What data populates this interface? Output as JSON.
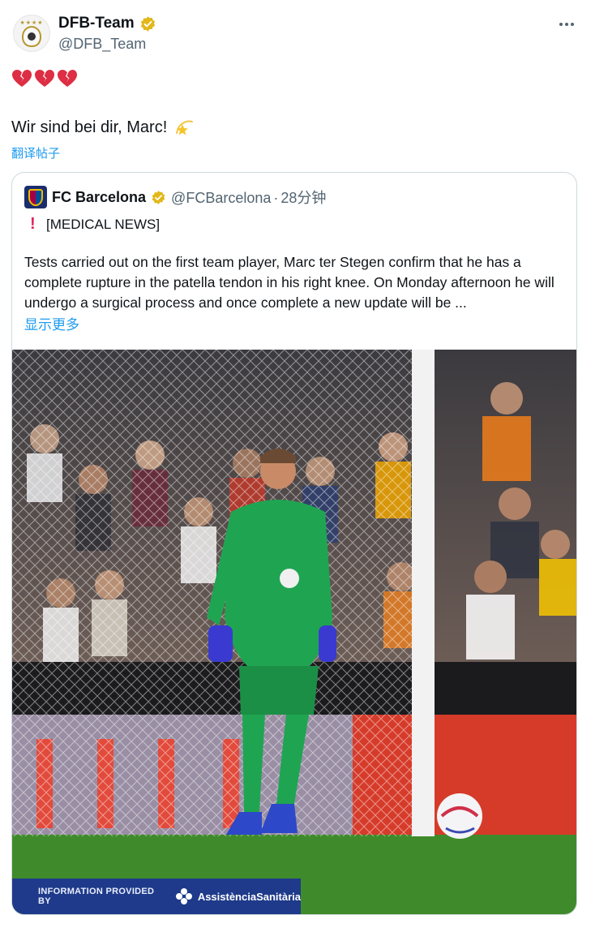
{
  "author": {
    "display_name": "DFB-Team",
    "handle": "@DFB_Team",
    "badge": "gold-verified-badge",
    "avatar": "dfb-crest-logo"
  },
  "menu": {
    "more_icon": "more-horizontal-icon"
  },
  "tweet": {
    "emoji_row": [
      "broken-heart",
      "broken-heart",
      "broken-heart"
    ],
    "text": "Wir sind bei dir, Marc!",
    "trailing_emoji": "dizzy-star",
    "translate_label": "翻译帖子"
  },
  "quote": {
    "display_name": "FC Barcelona",
    "handle": "@FCBarcelona",
    "separator": "·",
    "time": "28分钟",
    "avatar": "fcb-crest-logo",
    "headline": "[MEDICAL NEWS]",
    "headline_icon": "red-exclamation-icon",
    "body": "Tests carried out on the first team player, Marc ter Stegen confirm that he has a complete rupture in the patella tendon in his right knee. On Monday afternoon he will undergo a surgical process and once complete a new update will be ...",
    "show_more_label": "显示更多",
    "image": {
      "description_icon": "goalkeeper-photo",
      "banner_text": "INFORMATION PROVIDED BY",
      "banner_brand": "AssistènciaSanitària"
    }
  },
  "colors": {
    "link": "#1d9bf0",
    "muted": "#536471",
    "banner": "#1f3a8a",
    "jersey": "#1fa552"
  }
}
